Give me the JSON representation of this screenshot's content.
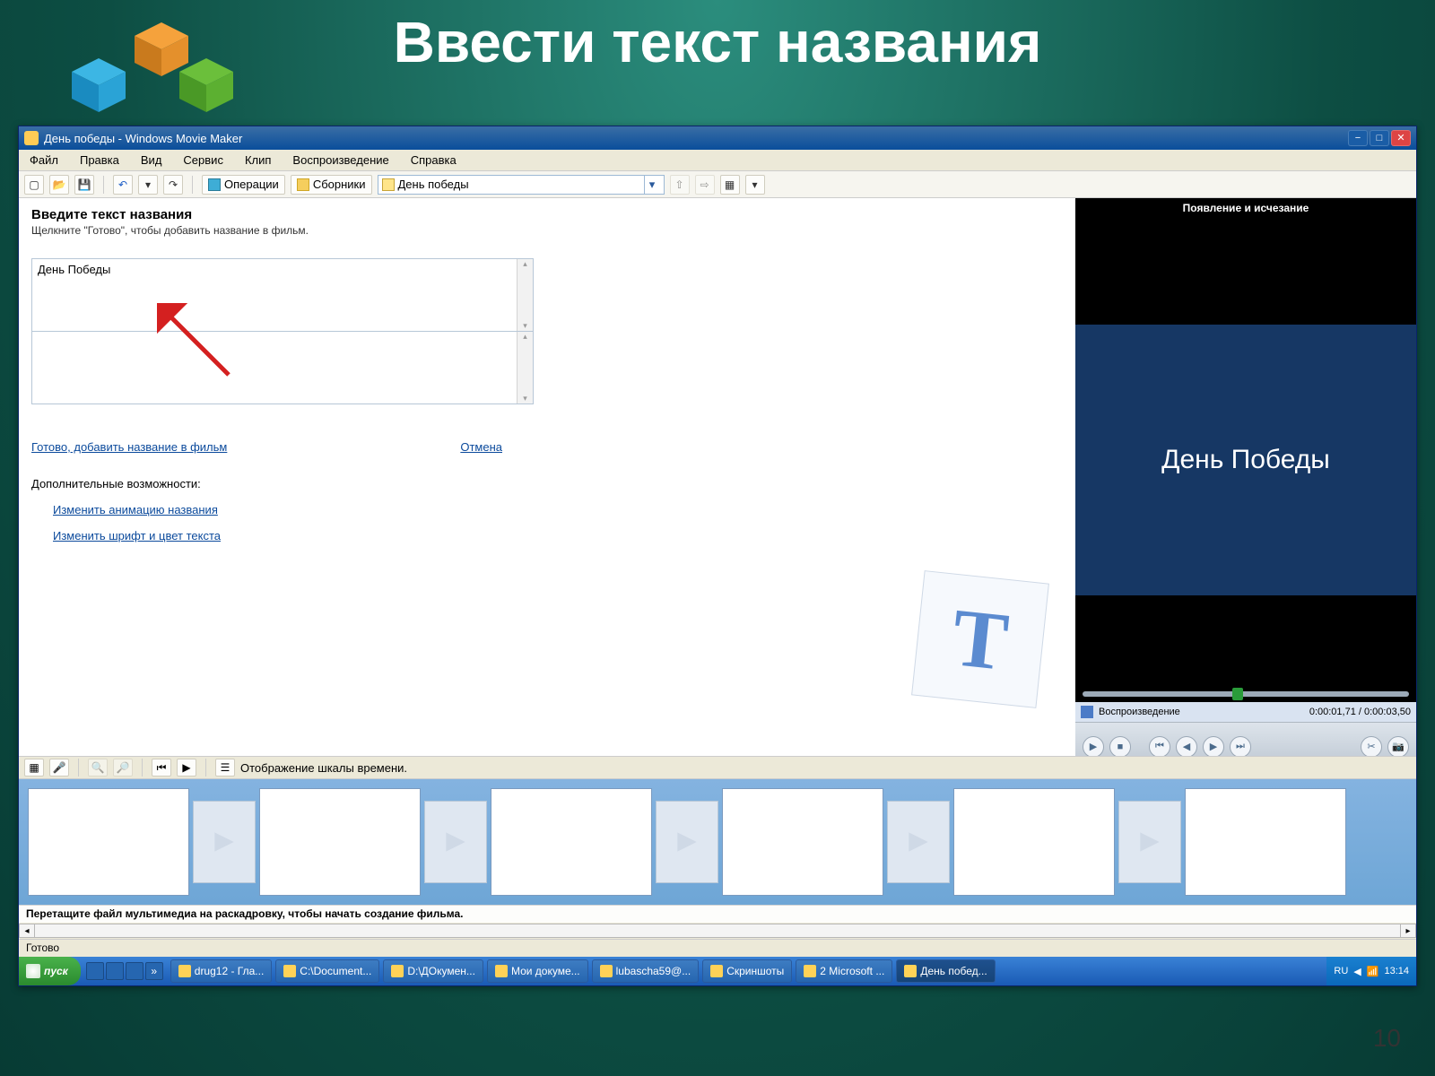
{
  "slide": {
    "title": "Ввести текст названия",
    "page_number": "10"
  },
  "window": {
    "title": "День победы - Windows Movie Maker"
  },
  "menu": {
    "items": [
      "Файл",
      "Правка",
      "Вид",
      "Сервис",
      "Клип",
      "Воспроизведение",
      "Справка"
    ]
  },
  "toolbar": {
    "operations_label": "Операции",
    "collections_label": "Сборники",
    "location_value": "День победы"
  },
  "panel": {
    "heading": "Введите текст названия",
    "subtitle": "Щелкните \"Готово\", чтобы добавить название в фильм.",
    "title_text": "День Победы",
    "done_link": "Готово, добавить название в фильм",
    "cancel_link": "Отмена",
    "options_label": "Дополнительные возможности:",
    "change_animation": "Изменить анимацию названия",
    "change_font": "Изменить шрифт и цвет текста"
  },
  "preview": {
    "header": "Появление и исчезание",
    "title_text": "День Победы",
    "playback_label": "Воспроизведение",
    "timecode": "0:00:01,71 / 0:00:03,50"
  },
  "timeline_toolbar": {
    "label": "Отображение шкалы времени."
  },
  "storyboard": {
    "hint": "Перетащите файл мультимедиа на раскадровку, чтобы начать создание фильма."
  },
  "statusbar": {
    "text": "Готово"
  },
  "taskbar": {
    "start": "пуск",
    "items": [
      {
        "label": "drug12 - Гла..."
      },
      {
        "label": "C:\\Document..."
      },
      {
        "label": "D:\\ДОкумен..."
      },
      {
        "label": "Мои докуме..."
      },
      {
        "label": "lubascha59@..."
      },
      {
        "label": "Скриншоты"
      },
      {
        "label": "2 Microsoft ..."
      },
      {
        "label": "День побед..."
      }
    ],
    "lang": "RU",
    "clock": "13:14"
  }
}
